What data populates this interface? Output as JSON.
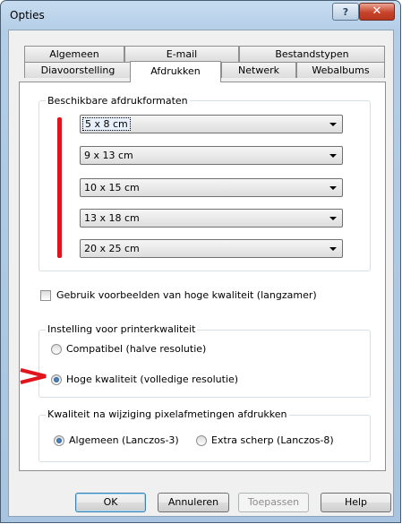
{
  "window": {
    "title": "Opties",
    "help_glyph": "?",
    "close_glyph": "✕"
  },
  "tabs": {
    "row1": [
      "Algemeen",
      "E-mail",
      "Bestandstypen"
    ],
    "row2": [
      "Diavoorstelling",
      "Afdrukken",
      "Netwerk",
      "Webalbums"
    ],
    "active": "Afdrukken"
  },
  "formats": {
    "label": "Beschikbare afdrukformaten",
    "options": [
      "5 x 8 cm",
      "9 x 13 cm",
      "10 x 15 cm",
      "13 x 18 cm",
      "20 x 25 cm"
    ]
  },
  "hq_preview": {
    "label": "Gebruik voorbeelden van hoge kwaliteit (langzamer)",
    "checked": false
  },
  "printer_quality": {
    "label": "Instelling voor printerkwaliteit",
    "options": [
      "Compatibel (halve resolutie)",
      "Hoge kwaliteit (volledige resolutie)"
    ],
    "selected": 1
  },
  "resample": {
    "label": "Kwaliteit na wijziging pixelafmetingen afdrukken",
    "options": [
      "Algemeen (Lanczos-3)",
      "Extra scherp (Lanczos-8)"
    ],
    "selected": 0
  },
  "buttons": {
    "ok": "OK",
    "cancel": "Annuleren",
    "apply": "Toepassen",
    "help": "Help"
  },
  "colors": {
    "annotation_red": "#e0141c"
  }
}
